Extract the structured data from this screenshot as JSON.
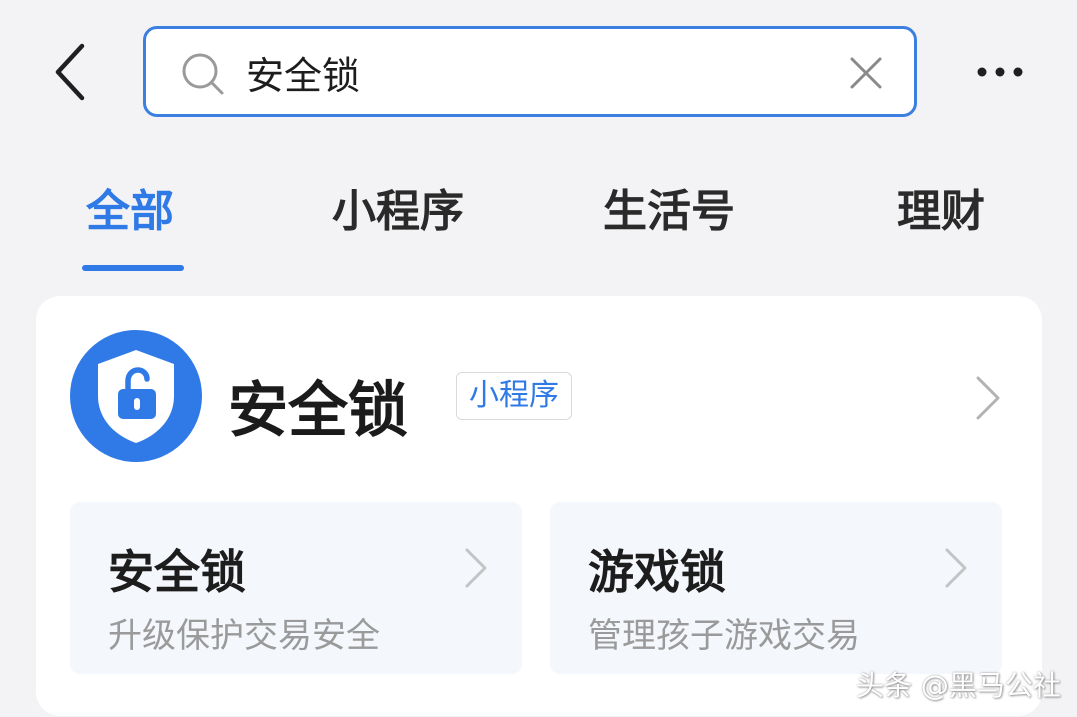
{
  "header": {
    "back_icon": "chevron-left-icon",
    "search": {
      "value": "安全锁",
      "icon": "search-icon",
      "clear_icon": "close-icon"
    },
    "more_icon": "more-dots-icon"
  },
  "tabs": [
    {
      "label": "全部",
      "active": true
    },
    {
      "label": "小程序",
      "active": false
    },
    {
      "label": "生活号",
      "active": false
    },
    {
      "label": "理财",
      "active": false
    }
  ],
  "result": {
    "app_name": "安全锁",
    "app_type": "小程序",
    "logo_icon": "shield-lock-icon",
    "services": [
      {
        "title": "安全锁",
        "description": "升级保护交易安全"
      },
      {
        "title": "游戏锁",
        "description": "管理孩子游戏交易"
      }
    ]
  },
  "watermark": "头条 @黑马公社",
  "colors": {
    "accent": "#2f7ae6",
    "search_border": "#3b7fe0",
    "background": "#f3f3f5",
    "card": "#ffffff",
    "sub_card": "#f4f7fc",
    "muted_text": "#9a9a9a"
  }
}
